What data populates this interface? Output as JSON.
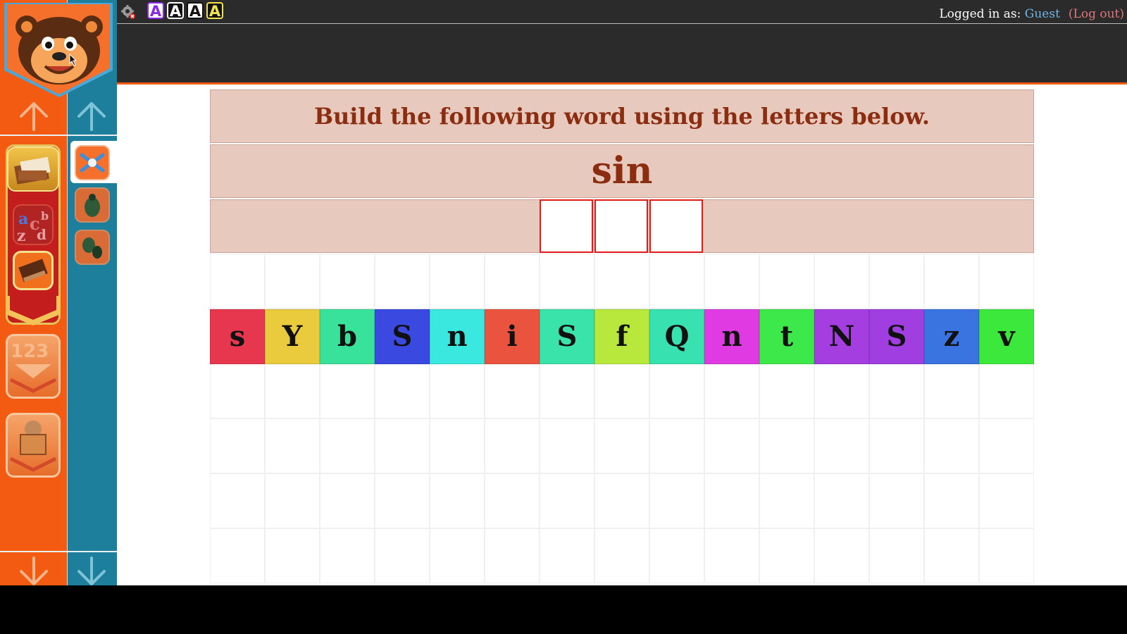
{
  "accessibility": {
    "contrast_options": [
      {
        "label": "A",
        "bg": "#ffffff",
        "fg": "#8a2be2",
        "border": "#8a2be2"
      },
      {
        "label": "A",
        "bg": "#111111",
        "fg": "#ffffff",
        "border": "#ffffff"
      },
      {
        "label": "A",
        "bg": "#ffffff",
        "fg": "#111111",
        "border": "#111111"
      },
      {
        "label": "A",
        "bg": "#111111",
        "fg": "#f2e24b",
        "border": "#f2e24b"
      }
    ]
  },
  "user": {
    "prefix": "Logged in as: ",
    "name": "Guest",
    "logout": "(Log out)"
  },
  "navigation": {
    "left": [
      {
        "name": "reading-books",
        "icon": "books-icon"
      },
      {
        "name": "alphabet",
        "icon": "alphabet-icon"
      },
      {
        "name": "book",
        "icon": "book-icon"
      },
      {
        "name": "numbers",
        "icon": "numbers-icon"
      },
      {
        "name": "character-box",
        "icon": "box-character-icon"
      }
    ],
    "right": [
      {
        "name": "puzzle-game",
        "icon": "bones-icon",
        "active": true
      },
      {
        "name": "beetle-game",
        "icon": "beetle-icon"
      },
      {
        "name": "beetles-game",
        "icon": "beetles-icon"
      }
    ]
  },
  "activity": {
    "instruction": "Build the following word using the letters below.",
    "target_word": "sin",
    "answer_slots": 3,
    "letters": [
      {
        "char": "s",
        "color": "#e7374e"
      },
      {
        "char": "Y",
        "color": "#ebcb3e"
      },
      {
        "char": "b",
        "color": "#38e29a"
      },
      {
        "char": "S",
        "color": "#3a4ae0"
      },
      {
        "char": "n",
        "color": "#3ae8e0"
      },
      {
        "char": "i",
        "color": "#ea533e"
      },
      {
        "char": "S",
        "color": "#3ae3a9"
      },
      {
        "char": "f",
        "color": "#b8e83b"
      },
      {
        "char": "Q",
        "color": "#38e2b0"
      },
      {
        "char": "n",
        "color": "#e03ae2"
      },
      {
        "char": "t",
        "color": "#3de84a"
      },
      {
        "char": "N",
        "color": "#a43ee0"
      },
      {
        "char": "S",
        "color": "#a03ee2"
      },
      {
        "char": "z",
        "color": "#3a74e0"
      },
      {
        "char": "v",
        "color": "#3de83d"
      }
    ]
  },
  "colors": {
    "sidebar_orange": "#f35a12",
    "sidebar_teal": "#1d7f9b",
    "topbar": "#2b2b2b",
    "band": "#e8c9bd",
    "title_text": "#8b2d10"
  }
}
